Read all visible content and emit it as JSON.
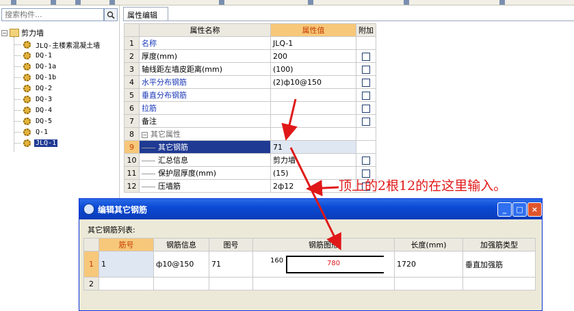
{
  "search": {
    "placeholder": "搜索构件..."
  },
  "tree": {
    "root": "剪力墙",
    "items": [
      "JLQ-主楼素混凝土墙",
      "DQ-1",
      "DQ-1a",
      "DQ-1b",
      "DQ-2",
      "DQ-3",
      "DQ-4",
      "DQ-5",
      "Q-1",
      "JLQ-1"
    ],
    "selected_index": 9
  },
  "properties": {
    "tab_label": "属性编辑",
    "headers": {
      "name": "属性名称",
      "value": "属性值",
      "extra": "附加"
    },
    "rows": [
      {
        "num": "1",
        "name": "名称",
        "value": "JLQ-1",
        "checkbox": false,
        "blue": true
      },
      {
        "num": "2",
        "name": "厚度(mm)",
        "value": "200",
        "checkbox": true,
        "blue": false
      },
      {
        "num": "3",
        "name": "轴线距左墙皮距离(mm)",
        "value": "(100)",
        "checkbox": true,
        "blue": false
      },
      {
        "num": "4",
        "name": "水平分布钢筋",
        "value": "(2)ф10@150",
        "checkbox": true,
        "blue": true
      },
      {
        "num": "5",
        "name": "垂直分布钢筋",
        "value": "",
        "checkbox": true,
        "blue": true
      },
      {
        "num": "6",
        "name": "拉筋",
        "value": "",
        "checkbox": true,
        "blue": true
      },
      {
        "num": "7",
        "name": "备注",
        "value": "",
        "checkbox": true,
        "blue": false
      },
      {
        "num": "8",
        "name": "其它属性",
        "value": "",
        "checkbox": false,
        "group": true
      },
      {
        "num": "9",
        "name": "其它钢筋",
        "value": "71",
        "checkbox": false,
        "sub": true,
        "selected": true
      },
      {
        "num": "10",
        "name": "汇总信息",
        "value": "剪力墙",
        "checkbox": true,
        "sub": true
      },
      {
        "num": "11",
        "name": "保护层厚度(mm)",
        "value": "(15)",
        "checkbox": true,
        "sub": true
      },
      {
        "num": "12",
        "name": "压墙筋",
        "value": "2ф12",
        "checkbox": true,
        "sub": true
      }
    ]
  },
  "annotation": {
    "text": "顶上的2根12的在这里输入。",
    "color": "#e01818"
  },
  "dialog": {
    "title": "编辑其它钢筋",
    "list_label": "其它钢筋列表:",
    "headers": [
      "筋号",
      "钢筋信息",
      "图号",
      "钢筋图形",
      "长度(mm)",
      "加强筋类型"
    ],
    "rows": [
      {
        "num": "1",
        "bar_no": "1",
        "info": "ф10@150",
        "shape_no": "71",
        "shape_left": "160",
        "shape_mid": "780",
        "length": "1720",
        "type": "垂直加强筋"
      },
      {
        "num": "2",
        "bar_no": "",
        "info": "",
        "shape_no": "",
        "shape_left": "",
        "shape_mid": "",
        "length": "",
        "type": ""
      }
    ],
    "buttons": {
      "minimize": "_",
      "maximize": "□",
      "close": "×"
    }
  }
}
